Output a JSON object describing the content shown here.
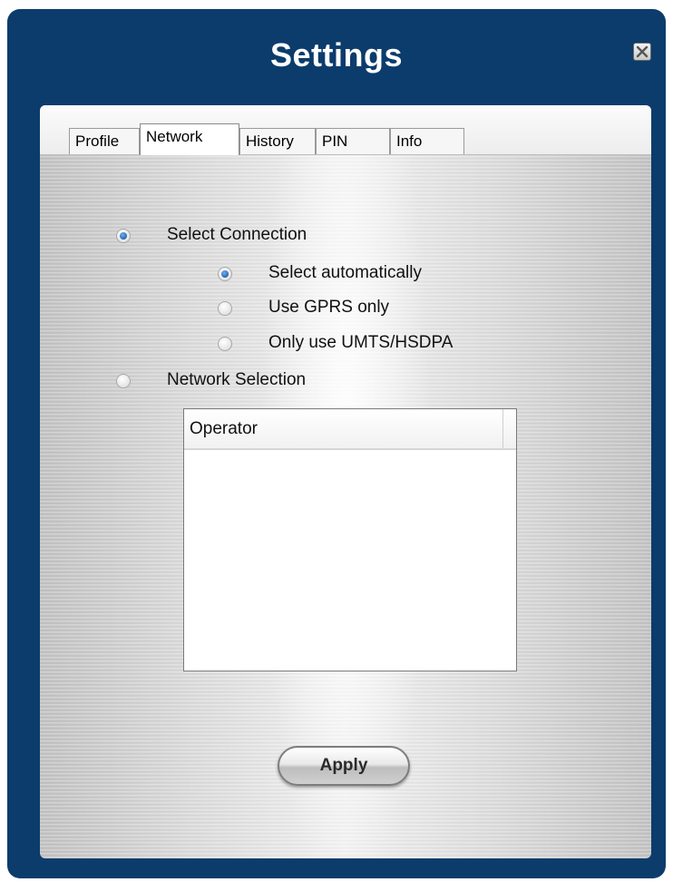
{
  "window": {
    "title": "Settings",
    "close_icon": "close-icon"
  },
  "tabs": [
    {
      "label": "Profile",
      "active": false
    },
    {
      "label": "Network",
      "active": true
    },
    {
      "label": "History",
      "active": false
    },
    {
      "label": "PIN",
      "active": false
    },
    {
      "label": "Info",
      "active": false
    }
  ],
  "connection": {
    "select_connection_label": "Select Connection",
    "select_connection_checked": true,
    "options": [
      {
        "label": "Select automatically",
        "checked": true
      },
      {
        "label": "Use GPRS only",
        "checked": false
      },
      {
        "label": "Only use UMTS/HSDPA",
        "checked": false
      }
    ],
    "network_selection_label": "Network Selection",
    "network_selection_checked": false
  },
  "operator_list": {
    "column_header": "Operator",
    "rows": []
  },
  "apply_label": "Apply",
  "colors": {
    "window_background": "#0b3c6c",
    "radio_selected": "#1c5ba8"
  }
}
